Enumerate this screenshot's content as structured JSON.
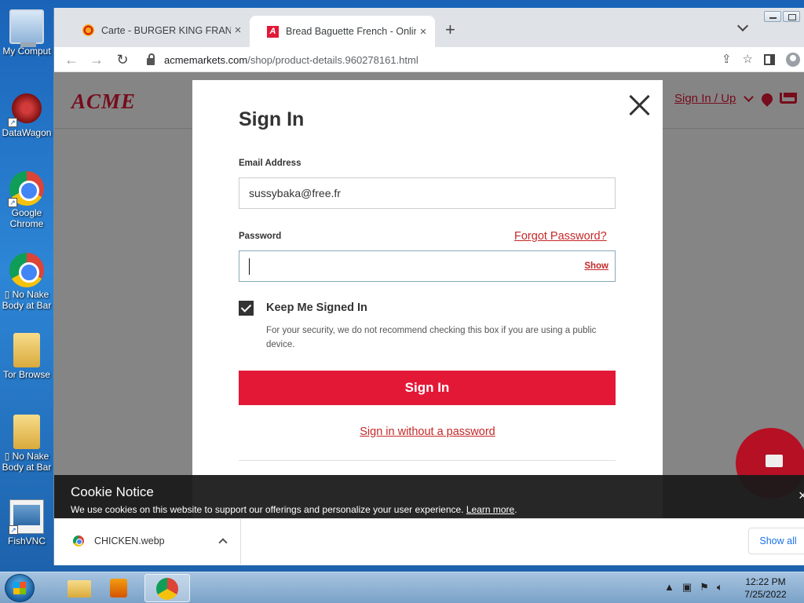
{
  "desktop": {
    "icons": [
      {
        "label": "My Comput",
        "icon": "computer-icon"
      },
      {
        "label": "DataWagon",
        "icon": "web-icon"
      },
      {
        "label": "Google",
        "label2": "Chrome",
        "icon": "chrome-icon"
      },
      {
        "label": "▯ No Nake",
        "label2": "Body at Bar",
        "icon": "chrome-icon"
      },
      {
        "label": "Tor Browse",
        "icon": "folder-icon"
      },
      {
        "label": "▯ No Nake",
        "label2": "Body at Bar",
        "icon": "folder-icon"
      },
      {
        "label": "FishVNC",
        "icon": "vnc-icon"
      }
    ]
  },
  "browser": {
    "tabs": [
      {
        "title": "Carte - BURGER KING FRANCE",
        "close": "×"
      },
      {
        "title": "Bread Baguette French - Online",
        "close": "×"
      }
    ],
    "new_tab": "+",
    "url_host": "acmemarkets.com",
    "url_path": "/shop/product-details.960278161.html"
  },
  "site": {
    "logo": "ACME",
    "signin_link": "Sign In / Up",
    "brand_color": "#e31837"
  },
  "modal": {
    "title": "Sign In",
    "email_label": "Email Address",
    "email_value": "sussybaka@free.fr",
    "password_label": "Password",
    "forgot_password": "Forgot Password?",
    "show_label": "Show",
    "keep_signed_in": "Keep Me Signed In",
    "keep_signed_in_checked": true,
    "security_note": "For your security, we do not recommend checking this box if you are using a public device.",
    "signin_button": "Sign In",
    "passwordless_link": "Sign in without a password"
  },
  "cookie": {
    "title": "Cookie Notice",
    "text": "We use cookies on this website to support our offerings and personalize your user experience.",
    "learn_more": "Learn more",
    "end": ".",
    "close": "×"
  },
  "downloads": {
    "file_name": "CHICKEN.webp",
    "show_all": "Show all"
  },
  "taskbar": {
    "time": "12:22 PM",
    "date": "7/25/2022"
  }
}
